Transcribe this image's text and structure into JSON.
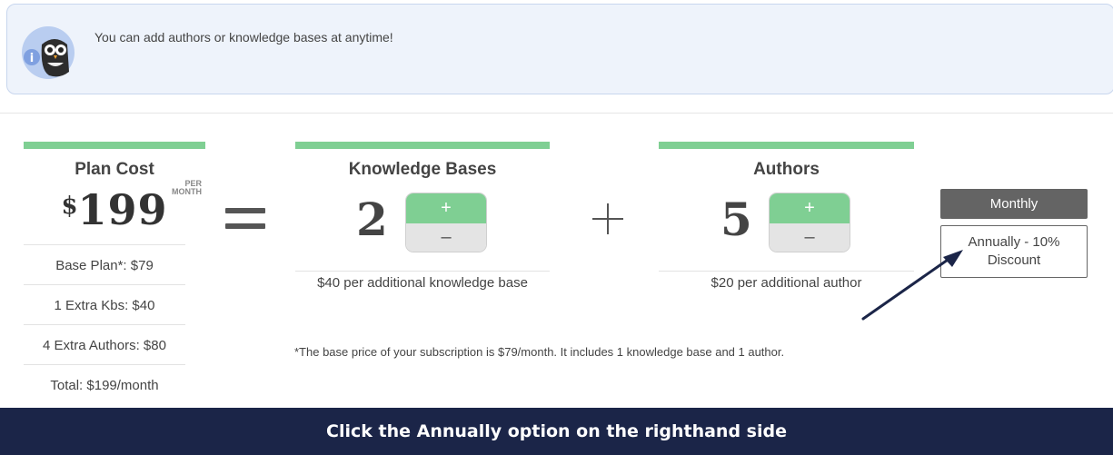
{
  "info": {
    "text": "You can add authors or knowledge bases at anytime!",
    "icon": "owl-info-icon"
  },
  "plan": {
    "title": "Plan Cost",
    "per_label_1": "PER",
    "per_label_2": "MONTH",
    "currency": "$",
    "price": "199",
    "breakdown": [
      "Base Plan*: $79",
      "1 Extra Kbs: $40",
      "4 Extra Authors: $80",
      "Total: $199/month"
    ]
  },
  "knowledge_bases": {
    "title": "Knowledge Bases",
    "count": "2",
    "plus": "+",
    "minus": "–",
    "note": "$40 per additional knowledge base"
  },
  "authors": {
    "title": "Authors",
    "count": "5",
    "plus": "+",
    "minus": "–",
    "note": "$20 per additional author"
  },
  "billing": {
    "monthly_label": "Monthly",
    "annual_label_1": "Annually - 10%",
    "annual_label_2": "Discount"
  },
  "footnote": "*The base price of your subscription is $79/month. It includes 1 knowledge base and 1 author.",
  "banner": {
    "text": "Click the Annually option on the righthand side"
  },
  "colors": {
    "accent_green": "#7fcf93",
    "banner_bg": "#1b2548",
    "info_bg": "#eef3fb",
    "monthly_bg": "#646464",
    "arrow": "#1b2548"
  }
}
